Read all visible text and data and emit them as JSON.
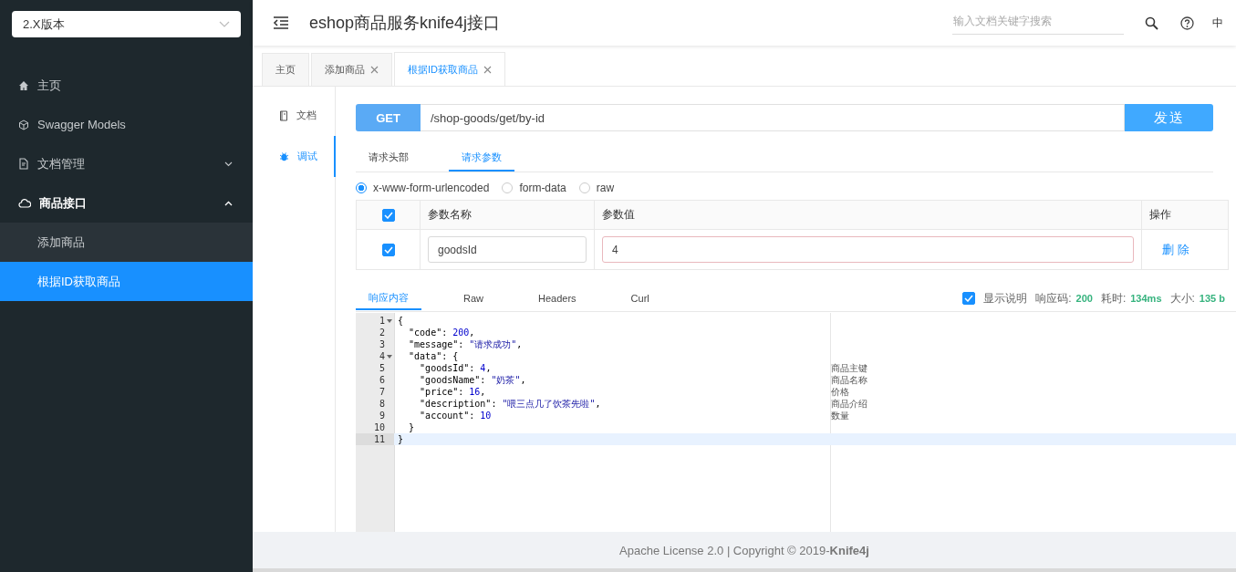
{
  "version_select": {
    "value": "2.X版本"
  },
  "sidebar": {
    "items": [
      {
        "label": "主页",
        "kind": "link",
        "selected": false
      },
      {
        "label": "Swagger Models",
        "kind": "link",
        "selected": false
      },
      {
        "label": "文档管理",
        "kind": "group",
        "selected": false,
        "expanded": false
      },
      {
        "label": "商品接口",
        "kind": "group",
        "selected": false,
        "expanded": true,
        "children": [
          {
            "label": "添加商品",
            "selected": false
          },
          {
            "label": "根据ID获取商品",
            "selected": true
          }
        ]
      }
    ]
  },
  "header": {
    "title": "eshop商品服务knife4j接口",
    "search": {
      "placeholder": "输入文档关键字搜索"
    },
    "language": "中"
  },
  "tabs": [
    {
      "label": "主页",
      "closable": false,
      "selected": false
    },
    {
      "label": "添加商品",
      "closable": true,
      "selected": false
    },
    {
      "label": "根据ID获取商品",
      "closable": true,
      "selected": true
    }
  ],
  "doc_nav": [
    {
      "label": "文档",
      "selected": false
    },
    {
      "label": "调试",
      "selected": true
    }
  ],
  "request": {
    "method": "GET",
    "url": "/shop-goods/get/by-id",
    "send": "发送"
  },
  "request_tabs": [
    {
      "label": "请求头部",
      "selected": false
    },
    {
      "label": "请求参数",
      "selected": true
    }
  ],
  "content_types": [
    {
      "label": "x-www-form-urlencoded",
      "selected": true
    },
    {
      "label": "form-data",
      "selected": false
    },
    {
      "label": "raw",
      "selected": false
    }
  ],
  "params": {
    "all_checked": true,
    "columns": [
      "参数名称",
      "参数值",
      "操作"
    ],
    "rows": [
      {
        "checked": true,
        "name": "goodsId",
        "value": "4",
        "action": "删 除"
      }
    ]
  },
  "response_tabs": [
    {
      "label": "响应内容",
      "selected": true
    },
    {
      "label": "Raw",
      "selected": false
    },
    {
      "label": "Headers",
      "selected": false
    },
    {
      "label": "Curl",
      "selected": false
    }
  ],
  "response_meta": {
    "show_notes": {
      "label": "显示说明",
      "checked": true
    },
    "status_label": "响应码:",
    "status": "200",
    "time_label": "耗时:",
    "time": "134ms",
    "size_label": "大小:",
    "size": "135 b"
  },
  "editor": {
    "lines": [
      {
        "number": "1",
        "text": "{",
        "foldable": true,
        "selected": false
      },
      {
        "number": "2",
        "text": "  \"code\": 200,",
        "foldable": false,
        "selected": false
      },
      {
        "number": "3",
        "text": "  \"message\": \"请求成功\",",
        "foldable": false,
        "selected": false
      },
      {
        "number": "4",
        "text": "  \"data\": {",
        "foldable": true,
        "selected": false
      },
      {
        "number": "5",
        "text": "    \"goodsId\": 4,",
        "foldable": false,
        "selected": false,
        "note": "商品主键"
      },
      {
        "number": "6",
        "text": "    \"goodsName\": \"奶茶\",",
        "foldable": false,
        "selected": false,
        "note": "商品名称"
      },
      {
        "number": "7",
        "text": "    \"price\": 16,",
        "foldable": false,
        "selected": false,
        "note": "价格"
      },
      {
        "number": "8",
        "text": "    \"description\": \"喂三点几了饮茶先啦\",",
        "foldable": false,
        "selected": false,
        "note": "商品介绍"
      },
      {
        "number": "9",
        "text": "    \"account\": 10",
        "foldable": false,
        "selected": false,
        "note": "数量"
      },
      {
        "number": "10",
        "text": "  }",
        "foldable": false,
        "selected": false
      },
      {
        "number": "11",
        "text": "}",
        "foldable": false,
        "selected": true
      }
    ]
  },
  "footer": {
    "text": "Apache License 2.0 | Copyright © 2019-**Knife4j**"
  }
}
